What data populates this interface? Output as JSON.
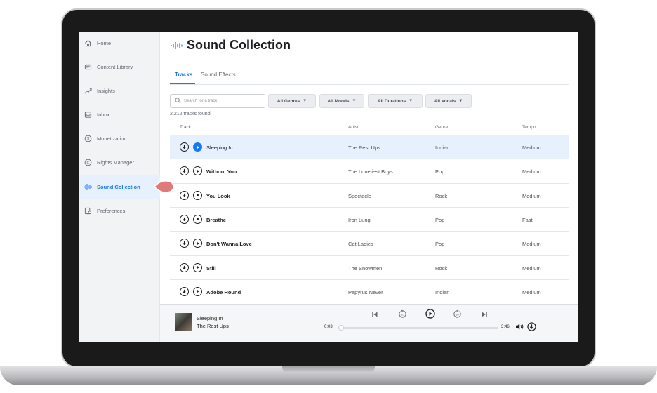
{
  "sidebar": {
    "items": [
      {
        "label": "Home",
        "icon": "home-icon"
      },
      {
        "label": "Content Library",
        "icon": "library-icon"
      },
      {
        "label": "Insights",
        "icon": "insights-icon"
      },
      {
        "label": "Inbox",
        "icon": "inbox-icon"
      },
      {
        "label": "Monetization",
        "icon": "dollar-icon"
      },
      {
        "label": "Rights Manager",
        "icon": "copyright-icon"
      },
      {
        "label": "Sound Collection",
        "icon": "sound-wave-icon"
      },
      {
        "label": "Preferences",
        "icon": "preferences-icon"
      }
    ],
    "active_index": 6
  },
  "header": {
    "title": "Sound Collection",
    "title_icon": "sound-wave-icon"
  },
  "tabs": [
    {
      "label": "Tracks",
      "active": true
    },
    {
      "label": "Sound Effects",
      "active": false
    }
  ],
  "search": {
    "placeholder": "Search for a track",
    "value": ""
  },
  "filters": [
    "All Genres",
    "All Moods",
    "All Durations",
    "All Vocals"
  ],
  "result_count": "2,212 tracks found",
  "table": {
    "columns": [
      "Track",
      "Artist",
      "Genre",
      "Tempo"
    ],
    "rows": [
      {
        "track": "Sleeping In",
        "artist": "The Rest Ups",
        "genre": "Indian",
        "tempo": "Medium",
        "selected": true
      },
      {
        "track": "Without You",
        "artist": "The Loneliest Boys",
        "genre": "Pop",
        "tempo": "Medium"
      },
      {
        "track": "You Look",
        "artist": "Spectacle",
        "genre": "Rock",
        "tempo": "Medium"
      },
      {
        "track": "Breathe",
        "artist": "Iron Lung",
        "genre": "Pop",
        "tempo": "Fast"
      },
      {
        "track": "Don't Wanna Love",
        "artist": "Cat Ladies",
        "genre": "Pop",
        "tempo": "Medium"
      },
      {
        "track": "Still",
        "artist": "The Snowmen",
        "genre": "Rock",
        "tempo": "Medium"
      },
      {
        "track": "Adobe Hound",
        "artist": "Papyrus Never",
        "genre": "Indian",
        "tempo": "Medium"
      }
    ]
  },
  "player": {
    "title": "Sleeping In",
    "artist": "The Rest Ups",
    "current_time": "0:03",
    "duration": "3:46",
    "progress_fraction": 0.013,
    "controls": [
      "previous-icon",
      "rewind-10-icon",
      "play-icon",
      "forward-10-icon",
      "next-icon",
      "volume-icon",
      "download-icon"
    ]
  },
  "colors": {
    "accent": "#1877f2",
    "sidebar_bg": "#f2f3f5",
    "selected_row": "#e7f0fd",
    "pointer": "#e07a7a"
  }
}
